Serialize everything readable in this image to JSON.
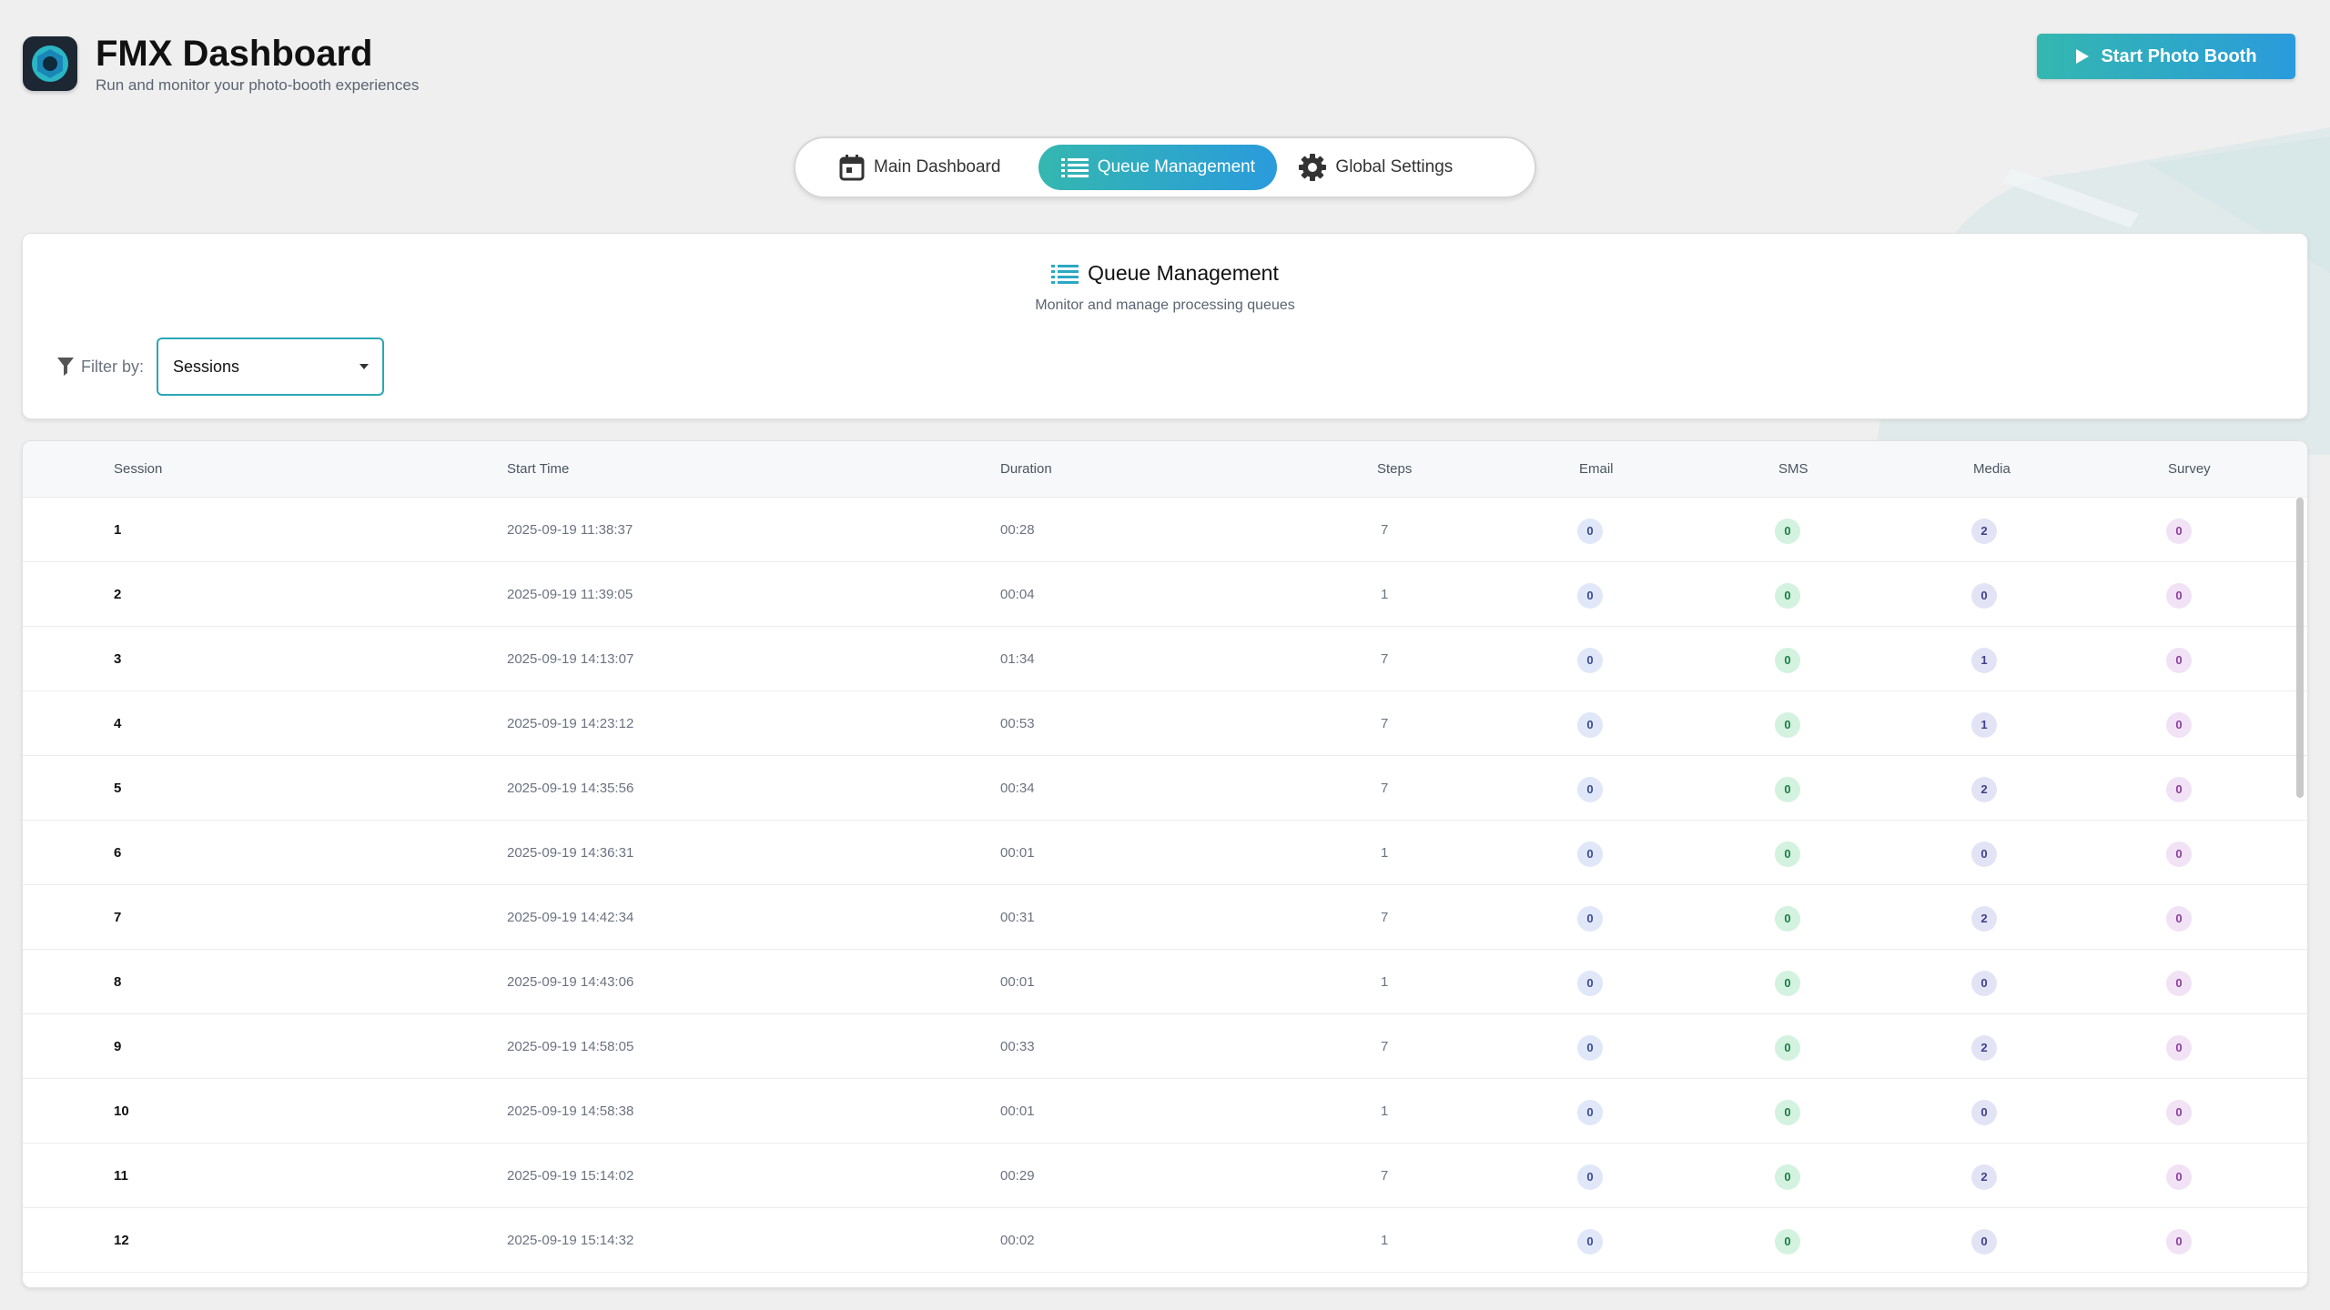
{
  "header": {
    "title": "FMX Dashboard",
    "subtitle": "Run and monitor your photo-booth experiences",
    "start_button": "Start Photo Booth"
  },
  "tabs": [
    {
      "label": "Main Dashboard",
      "icon": "calendar-icon",
      "active": false
    },
    {
      "label": "Queue Management",
      "icon": "list-icon",
      "active": true
    },
    {
      "label": "Global Settings",
      "icon": "gear-icon",
      "active": false
    }
  ],
  "queue": {
    "title": "Queue Management",
    "subtitle": "Monitor and manage processing queues",
    "filter_label": "Filter by:",
    "filter_value": "Sessions"
  },
  "table": {
    "columns": [
      "Session",
      "Start Time",
      "Duration",
      "Steps",
      "Email",
      "SMS",
      "Media",
      "Survey"
    ],
    "rows": [
      {
        "session": "1",
        "start": "2025-09-19 11:38:37",
        "duration": "00:28",
        "steps": "7",
        "email": "0",
        "sms": "0",
        "media": "2",
        "survey": "0"
      },
      {
        "session": "2",
        "start": "2025-09-19 11:39:05",
        "duration": "00:04",
        "steps": "1",
        "email": "0",
        "sms": "0",
        "media": "0",
        "survey": "0"
      },
      {
        "session": "3",
        "start": "2025-09-19 14:13:07",
        "duration": "01:34",
        "steps": "7",
        "email": "0",
        "sms": "0",
        "media": "1",
        "survey": "0"
      },
      {
        "session": "4",
        "start": "2025-09-19 14:23:12",
        "duration": "00:53",
        "steps": "7",
        "email": "0",
        "sms": "0",
        "media": "1",
        "survey": "0"
      },
      {
        "session": "5",
        "start": "2025-09-19 14:35:56",
        "duration": "00:34",
        "steps": "7",
        "email": "0",
        "sms": "0",
        "media": "2",
        "survey": "0"
      },
      {
        "session": "6",
        "start": "2025-09-19 14:36:31",
        "duration": "00:01",
        "steps": "1",
        "email": "0",
        "sms": "0",
        "media": "0",
        "survey": "0"
      },
      {
        "session": "7",
        "start": "2025-09-19 14:42:34",
        "duration": "00:31",
        "steps": "7",
        "email": "0",
        "sms": "0",
        "media": "2",
        "survey": "0"
      },
      {
        "session": "8",
        "start": "2025-09-19 14:43:06",
        "duration": "00:01",
        "steps": "1",
        "email": "0",
        "sms": "0",
        "media": "0",
        "survey": "0"
      },
      {
        "session": "9",
        "start": "2025-09-19 14:58:05",
        "duration": "00:33",
        "steps": "7",
        "email": "0",
        "sms": "0",
        "media": "2",
        "survey": "0"
      },
      {
        "session": "10",
        "start": "2025-09-19 14:58:38",
        "duration": "00:01",
        "steps": "1",
        "email": "0",
        "sms": "0",
        "media": "0",
        "survey": "0"
      },
      {
        "session": "11",
        "start": "2025-09-19 15:14:02",
        "duration": "00:29",
        "steps": "7",
        "email": "0",
        "sms": "0",
        "media": "2",
        "survey": "0"
      },
      {
        "session": "12",
        "start": "2025-09-19 15:14:32",
        "duration": "00:02",
        "steps": "1",
        "email": "0",
        "sms": "0",
        "media": "0",
        "survey": "0"
      }
    ]
  },
  "colors": {
    "accent_start": "#34b7b0",
    "accent_end": "#2a9bdc",
    "background": "#efefef"
  }
}
